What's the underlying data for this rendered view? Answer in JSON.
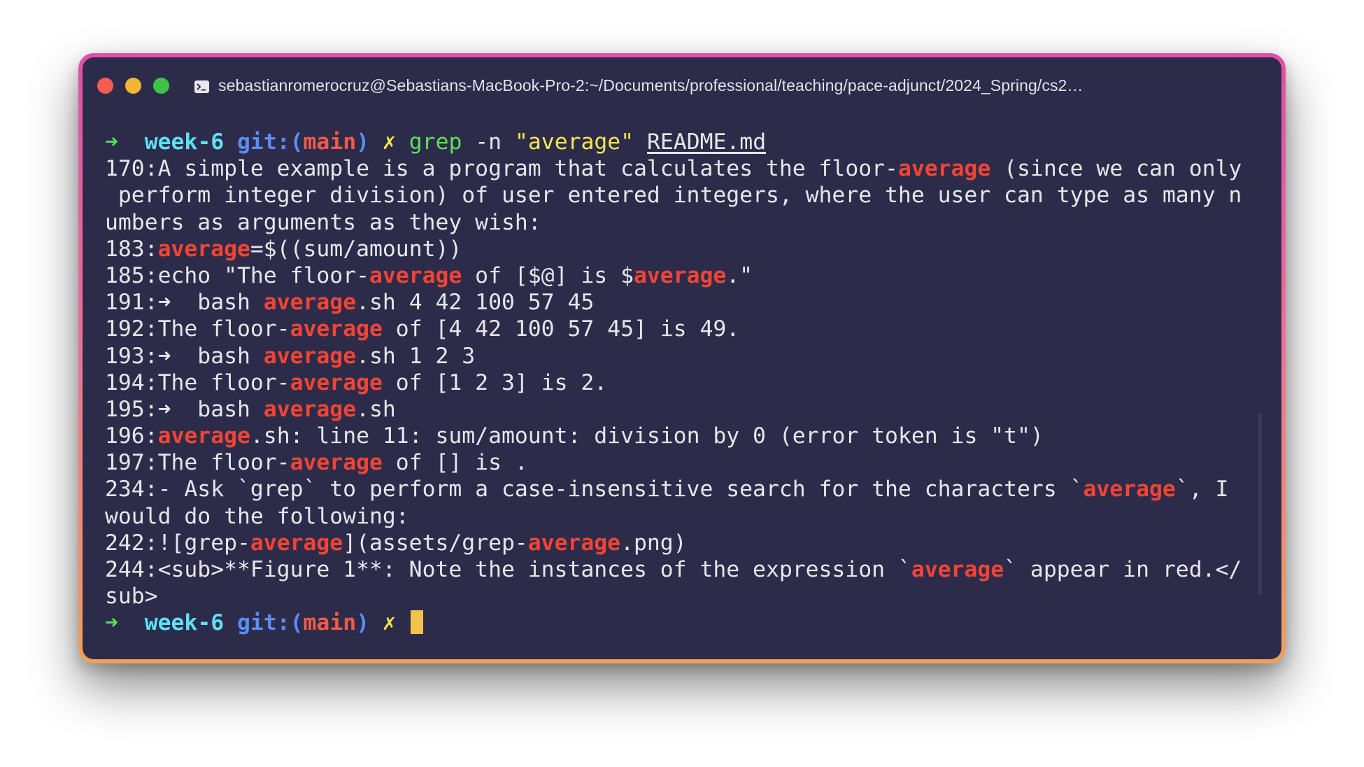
{
  "window": {
    "title": "sebastianromerocruz@Sebastians-MacBook-Pro-2:~/Documents/professional/teaching/pace-adjunct/2024_Spring/cs2…",
    "colors": {
      "background": "#2c2c4a",
      "match": "#f34435",
      "prompt_arrow": "#54e05a",
      "directory": "#5ee0f6",
      "git": "#5b8df6",
      "branch": "#f35a4a",
      "dirty_mark": "#f6e64e",
      "cursor": "#f2c24c"
    }
  },
  "prompt": {
    "arrow": "➜",
    "dir": "week-6",
    "git_label": "git:(",
    "branch": "main",
    "git_close": ")",
    "dirty": "✗",
    "command": "grep",
    "flag": "-n",
    "pattern": "\"average\"",
    "file": "README.md"
  },
  "output": [
    "170:A simple example is a program that calculates the floor-average (since we can only",
    " perform integer division) of user entered integers, where the user can type as many n",
    "umbers as arguments as they wish:",
    "183:average=$((sum/amount))",
    "185:echo \"The floor-average of [$@] is $average.\"",
    "191:➜  bash average.sh 4 42 100 57 45",
    "192:The floor-average of [4 42 100 57 45] is 49.",
    "193:➜  bash average.sh 1 2 3",
    "194:The floor-average of [1 2 3] is 2.",
    "195:➜  bash average.sh",
    "196:average.sh: line 11: sum/amount: division by 0 (error token is \"t\")",
    "197:The floor-average of [] is .",
    "234:- Ask `grep` to perform a case-insensitive search for the characters `average`, I",
    "would do the following:",
    "242:![grep-average](assets/grep-average.png)",
    "244:<sub>**Figure 1**: Note the instances of the expression `average` appear in red.</",
    "sub>"
  ],
  "highlight": "average",
  "final_prompt": {
    "arrow": "➜",
    "dir": "week-6",
    "git_label": "git:(",
    "branch": "main",
    "git_close": ")",
    "dirty": "✗"
  }
}
